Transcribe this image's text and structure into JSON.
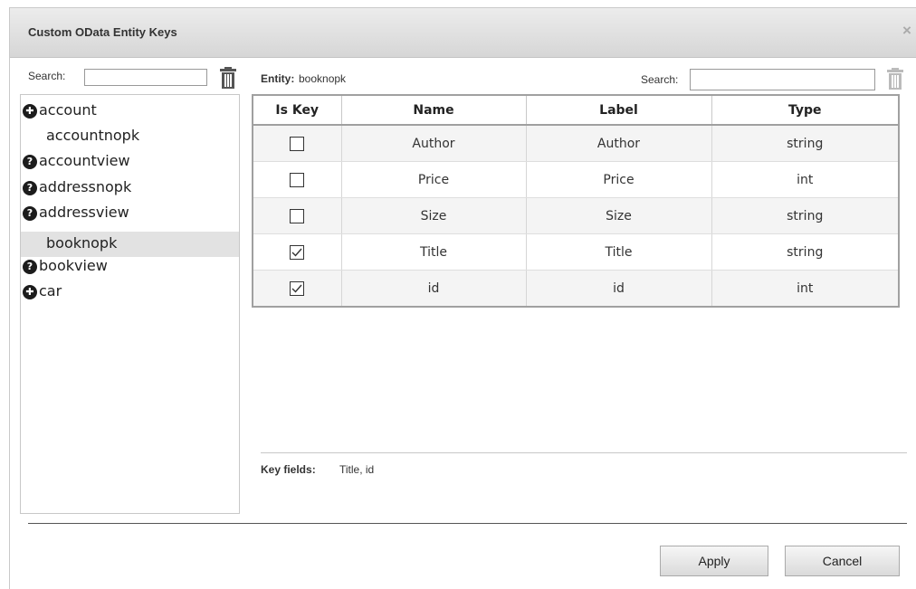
{
  "dialog": {
    "title": "Custom OData Entity Keys",
    "close_glyph": "×"
  },
  "left": {
    "search_label": "Search:",
    "search_value": "",
    "items": [
      {
        "label": "account",
        "icon": "plus-circle-icon",
        "glyph": "✚"
      },
      {
        "label": "accountnopk",
        "icon": "",
        "glyph": ""
      },
      {
        "label": "accountview",
        "icon": "question-circle-icon",
        "glyph": "?"
      },
      {
        "label": "addressnopk",
        "icon": "question-circle-icon",
        "glyph": "?"
      },
      {
        "label": "addressview",
        "icon": "question-circle-icon",
        "glyph": "?"
      },
      {
        "label": "booknopk",
        "icon": "",
        "glyph": ""
      },
      {
        "label": "bookview",
        "icon": "question-circle-icon",
        "glyph": "?"
      },
      {
        "label": "car",
        "icon": "plus-circle-icon",
        "glyph": "✚"
      }
    ],
    "selected": "booknopk"
  },
  "right": {
    "entity_label": "Entity:",
    "entity_name": "booknopk",
    "search_label": "Search:",
    "search_value": "",
    "columns": [
      "Is Key",
      "Name",
      "Label",
      "Type"
    ],
    "rows": [
      {
        "is_key": false,
        "name": "Author",
        "label": "Author",
        "type": "string"
      },
      {
        "is_key": false,
        "name": "Price",
        "label": "Price",
        "type": "int"
      },
      {
        "is_key": false,
        "name": "Size",
        "label": "Size",
        "type": "string"
      },
      {
        "is_key": true,
        "name": "Title",
        "label": "Title",
        "type": "string"
      },
      {
        "is_key": true,
        "name": "id",
        "label": "id",
        "type": "int"
      }
    ],
    "key_fields_label": "Key fields:",
    "key_fields_value": "Title, id"
  },
  "buttons": {
    "apply": "Apply",
    "cancel": "Cancel"
  }
}
